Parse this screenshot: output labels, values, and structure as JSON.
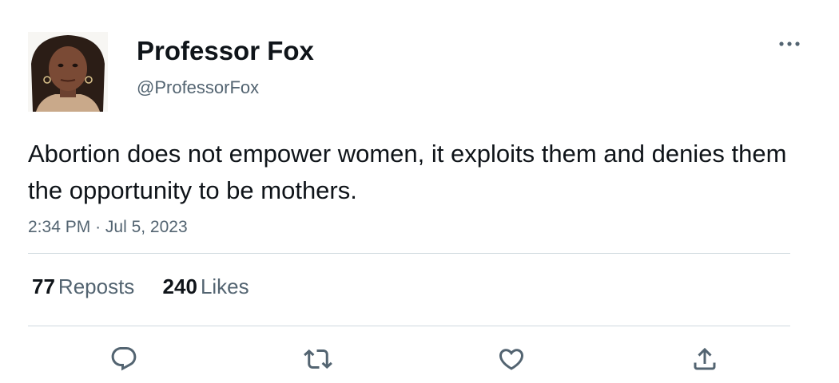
{
  "author": {
    "display_name": "Professor Fox",
    "handle": "@ProfessorFox"
  },
  "tweet": {
    "text": "Abortion does not empower women, it exploits them and denies them the opportunity to be mothers.",
    "time": "2:34 PM",
    "separator": "·",
    "date": "Jul 5, 2023"
  },
  "stats": {
    "reposts_count": "77",
    "reposts_label": "Reposts",
    "likes_count": "240",
    "likes_label": "Likes"
  },
  "icons": {
    "more": "more-horizontal-icon",
    "reply": "reply-icon",
    "repost": "repost-icon",
    "like": "heart-icon",
    "share": "share-icon"
  },
  "colors": {
    "text": "#0f1419",
    "secondary": "#536471",
    "divider": "#cfd9de"
  }
}
